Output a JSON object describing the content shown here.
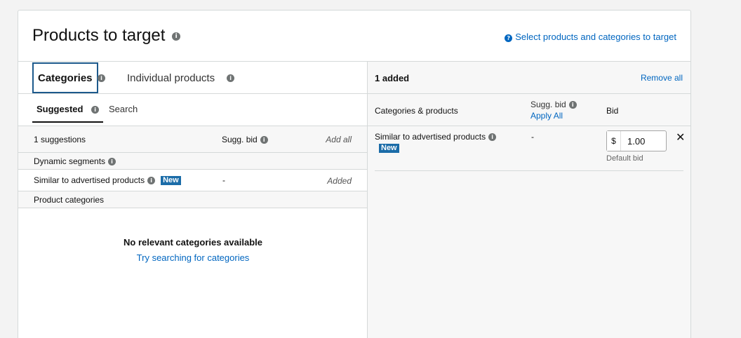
{
  "header": {
    "title": "Products to target",
    "help_link": "Select products and categories to target"
  },
  "tabs": {
    "categories": "Categories",
    "individual_products": "Individual products"
  },
  "subtabs": {
    "suggested": "Suggested",
    "search": "Search"
  },
  "left_table": {
    "count": "1 suggestions",
    "sugg_bid": "Sugg. bid",
    "add_all": "Add all",
    "sections": {
      "dynamic": "Dynamic segments",
      "product_categories": "Product categories"
    },
    "rows": [
      {
        "name": "Similar to advertised products",
        "badge": "New",
        "sugg_bid": "-",
        "status": "Added"
      }
    ],
    "empty_title": "No relevant categories available",
    "empty_link": "Try searching for categories"
  },
  "right_panel": {
    "added_count": "1 added",
    "remove_all": "Remove all",
    "col_categories": "Categories & products",
    "col_sugg_bid": "Sugg. bid",
    "apply_all": "Apply All",
    "col_bid": "Bid",
    "rows": [
      {
        "name": "Similar to advertised products",
        "badge": "New",
        "sugg_bid": "-",
        "currency": "$",
        "bid": "1.00",
        "bid_note": "Default bid"
      }
    ]
  },
  "colors": {
    "link": "#0066c0",
    "badge": "#1b6ca8",
    "border": "#d5d9d9"
  },
  "icons": {
    "info": "info-icon",
    "help": "question-circle-icon",
    "remove": "close-icon"
  }
}
